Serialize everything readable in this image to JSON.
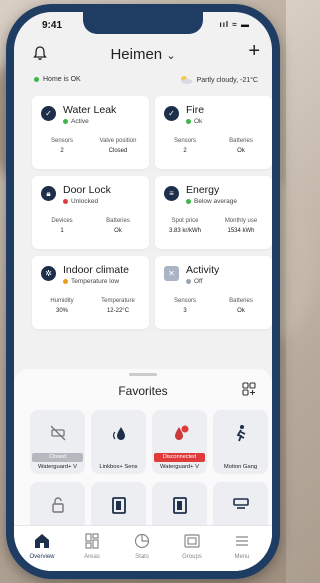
{
  "status_bar": {
    "time": "9:41",
    "icons": "ııl ≈ ▬"
  },
  "header": {
    "home_name": "Heimen",
    "dropdown": "⌄",
    "add": "+"
  },
  "summary": {
    "home_status": "Home is OK",
    "weather": "Partly cloudy, -21°C"
  },
  "cards": [
    {
      "title": "Water Leak",
      "status": "Active",
      "status_color": "#3db54a",
      "icon": "shield-check-icon",
      "stats": [
        {
          "label": "Sensors",
          "value": "2"
        },
        {
          "label": "Valve position",
          "value": "Closed"
        }
      ]
    },
    {
      "title": "Fire",
      "status": "Ok",
      "status_color": "#3db54a",
      "icon": "shield-check-icon",
      "stats": [
        {
          "label": "Sensors",
          "value": "2"
        },
        {
          "label": "Batteries",
          "value": "Ok"
        }
      ]
    },
    {
      "title": "Door Lock",
      "status": "Unlocked",
      "status_color": "#e03b3b",
      "icon": "lock-icon",
      "stats": [
        {
          "label": "Devices",
          "value": "1"
        },
        {
          "label": "Batteries",
          "value": "Ok"
        }
      ]
    },
    {
      "title": "Energy",
      "status": "Below average",
      "status_color": "#3db54a",
      "icon": "energy-meter-icon",
      "stats": [
        {
          "label": "Spot price",
          "value": "3.83 kr/kWh"
        },
        {
          "label": "Monthly use",
          "value": "1534 kWh"
        }
      ]
    },
    {
      "title": "Indoor climate",
      "status": "Temperature low",
      "status_color": "#f39a1e",
      "icon": "climate-icon",
      "stats": [
        {
          "label": "Humidity",
          "value": "30%"
        },
        {
          "label": "Temperature",
          "value": "12-22°C"
        }
      ]
    },
    {
      "title": "Activity",
      "status": "Off",
      "status_color": "#9aa3ae",
      "icon": "activity-shield-icon",
      "stats": [
        {
          "label": "Sensors",
          "value": "3"
        },
        {
          "label": "Batteries",
          "value": "Ok"
        }
      ]
    }
  ],
  "favorites": {
    "title": "Favorites",
    "tiles": [
      {
        "name": "Waterguard+ V",
        "badge": "Closed",
        "badge_color": "#b5b9bf",
        "icon": "valve-closed-icon"
      },
      {
        "name": "Linkbox+ Sens",
        "badge": "",
        "badge_color": "",
        "icon": "water-drop-icon"
      },
      {
        "name": "Waterguard+ V",
        "badge": "Disconnected",
        "badge_color": "#e03b3b",
        "icon": "water-alert-icon"
      },
      {
        "name": "Motion Gang",
        "badge": "",
        "badge_color": "",
        "icon": "motion-icon"
      },
      {
        "name": "",
        "badge": "",
        "badge_color": "",
        "icon": "lock-icon"
      },
      {
        "name": "",
        "badge": "",
        "badge_color": "",
        "icon": "window-icon"
      },
      {
        "name": "",
        "badge": "",
        "badge_color": "",
        "icon": "window-icon"
      },
      {
        "name": "",
        "badge": "",
        "badge_color": "",
        "icon": "device-icon"
      }
    ]
  },
  "tabs": [
    {
      "label": "Overview",
      "icon": "home-icon",
      "active": true
    },
    {
      "label": "Areas",
      "icon": "areas-icon",
      "active": false
    },
    {
      "label": "Stats",
      "icon": "stats-icon",
      "active": false
    },
    {
      "label": "Groups",
      "icon": "groups-icon",
      "active": false
    },
    {
      "label": "Menu",
      "icon": "menu-icon",
      "active": false
    }
  ]
}
